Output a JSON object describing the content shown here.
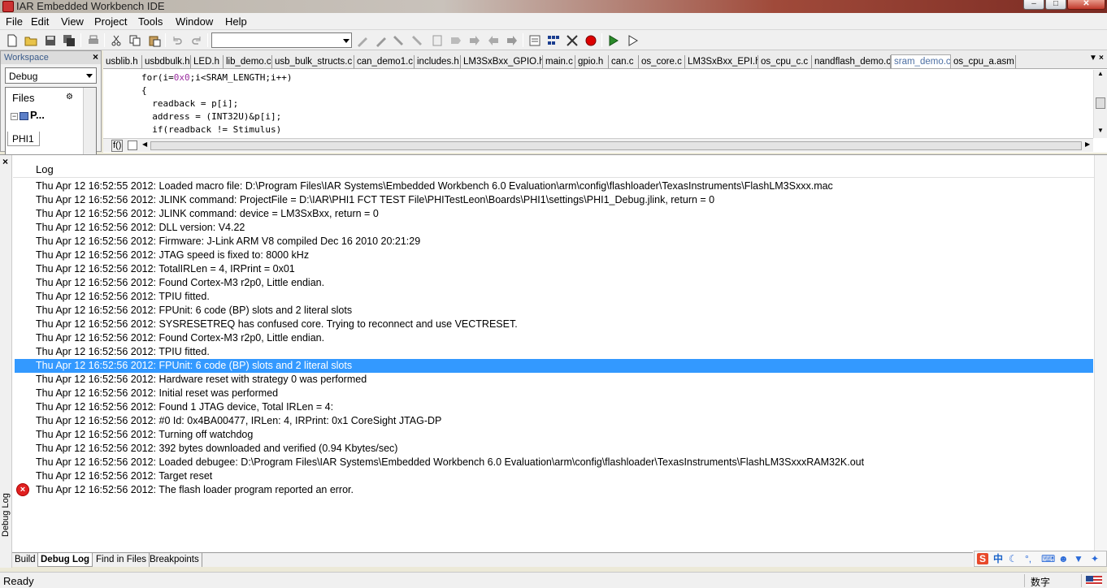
{
  "window": {
    "title": "IAR Embedded Workbench IDE"
  },
  "menu": [
    "File",
    "Edit",
    "View",
    "Project",
    "Tools",
    "Window",
    "Help"
  ],
  "workspace": {
    "label": "Workspace",
    "config": "Debug",
    "files_label": "Files",
    "tree_item": "P...",
    "project_tab": "PHI1"
  },
  "editor": {
    "tabs": [
      "usblib.h",
      "usbdbulk.h",
      "LED.h",
      "lib_demo.c",
      "usb_bulk_structs.c",
      "can_demo1.c",
      "includes.h",
      "LM3SxBxx_GPIO.h",
      "main.c",
      "gpio.h",
      "can.c",
      "os_core.c",
      "LM3SxBxx_EPI.h",
      "os_cpu_c.c",
      "nandflash_demo.c",
      "sram_demo.c",
      "os_cpu_a.asm"
    ],
    "active_tab": "sram_demo.c",
    "code": {
      "l1a": "for(i=",
      "l1num": "0x0",
      "l1b": ";i<SRAM_LENGTH;i++)",
      "l2": "{",
      "l3": "  readback = p[i];",
      "l4": "  address = (INT32U)&p[i];",
      "l5": "  if(readback != Stimulus)"
    },
    "hscroll_label": "f()"
  },
  "log": {
    "header": "Log",
    "side_label": "Debug Log",
    "rows": [
      "Thu Apr 12 16:52:55 2012: Loaded macro file: D:\\Program Files\\IAR Systems\\Embedded Workbench 6.0 Evaluation\\arm\\config\\flashloader\\TexasInstruments\\FlashLM3Sxxx.mac",
      "Thu Apr 12 16:52:56 2012: JLINK command: ProjectFile = D:\\IAR\\PHI1 FCT TEST File\\PHITestLeon\\Boards\\PHI1\\settings\\PHI1_Debug.jlink, return = 0",
      "Thu Apr 12 16:52:56 2012: JLINK command: device = LM3SxBxx, return = 0",
      "Thu Apr 12 16:52:56 2012: DLL version: V4.22",
      "Thu Apr 12 16:52:56 2012: Firmware: J-Link ARM V8 compiled Dec 16 2010 20:21:29",
      "Thu Apr 12 16:52:56 2012: JTAG speed is fixed to: 8000 kHz",
      "Thu Apr 12 16:52:56 2012: TotalIRLen = 4, IRPrint = 0x01",
      "Thu Apr 12 16:52:56 2012: Found Cortex-M3 r2p0, Little endian.",
      "Thu Apr 12 16:52:56 2012: TPIU fitted.",
      "Thu Apr 12 16:52:56 2012:   FPUnit: 6 code (BP) slots and 2 literal slots",
      "Thu Apr 12 16:52:56 2012: SYSRESETREQ has confused core. Trying to reconnect and use VECTRESET.",
      "Thu Apr 12 16:52:56 2012: Found Cortex-M3 r2p0, Little endian.",
      "Thu Apr 12 16:52:56 2012: TPIU fitted.",
      "Thu Apr 12 16:52:56 2012:   FPUnit: 6 code (BP) slots and 2 literal slots",
      "Thu Apr 12 16:52:56 2012: Hardware reset with strategy 0 was performed",
      "Thu Apr 12 16:52:56 2012: Initial reset was performed",
      "Thu Apr 12 16:52:56 2012: Found 1 JTAG device, Total IRLen = 4:",
      "Thu Apr 12 16:52:56 2012:  #0 Id: 0x4BA00477, IRLen:  4, IRPrint: 0x1 CoreSight JTAG-DP",
      "Thu Apr 12 16:52:56 2012: Turning off watchdog",
      "Thu Apr 12 16:52:56 2012: 392 bytes downloaded and verified (0.94 Kbytes/sec)",
      "Thu Apr 12 16:52:56 2012: Loaded debugee: D:\\Program Files\\IAR Systems\\Embedded Workbench 6.0 Evaluation\\arm\\config\\flashloader\\TexasInstruments\\FlashLM3SxxxRAM32K.out",
      "Thu Apr 12 16:52:56 2012: Target reset",
      "Thu Apr 12 16:52:56 2012: The flash loader program reported an error."
    ],
    "selected_row": 13,
    "error_row": 22
  },
  "bottom_tabs": [
    "Build",
    "Debug Log",
    "Find in Files",
    "Breakpoints"
  ],
  "active_bottom_tab": "Debug Log",
  "ime": {
    "zh": "中",
    "punct": "°,"
  },
  "status": {
    "text": "Ready",
    "num": "数字"
  },
  "colors": {
    "selection": "#3399ff",
    "error": "#e02020",
    "active_tab_text": "#4d6fa3"
  }
}
